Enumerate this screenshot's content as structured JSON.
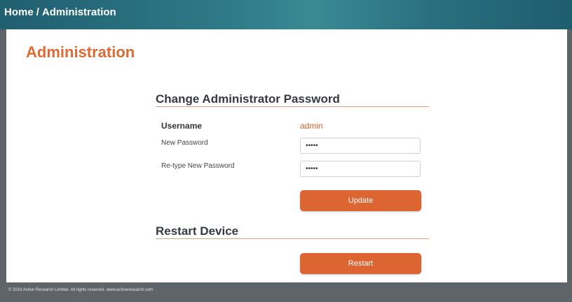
{
  "breadcrumb": {
    "home": "Home",
    "separator": "/",
    "current": "Administration"
  },
  "page_title": "Administration",
  "change_password": {
    "title": "Change Administrator Password",
    "username_label": "Username",
    "username_value": "admin",
    "new_password_label": "New Password",
    "new_password_value": "•••••",
    "retype_label": "Re-type New Password",
    "retype_value": "•••••",
    "update_button": "Update"
  },
  "restart": {
    "title": "Restart Device",
    "restart_button": "Restart"
  },
  "footer": {
    "text": "© 2019 Active Research Limited. All rights reserved. www.activeresearch.com"
  },
  "colors": {
    "accent": "#dd6532",
    "banner": "#2f7a88"
  }
}
